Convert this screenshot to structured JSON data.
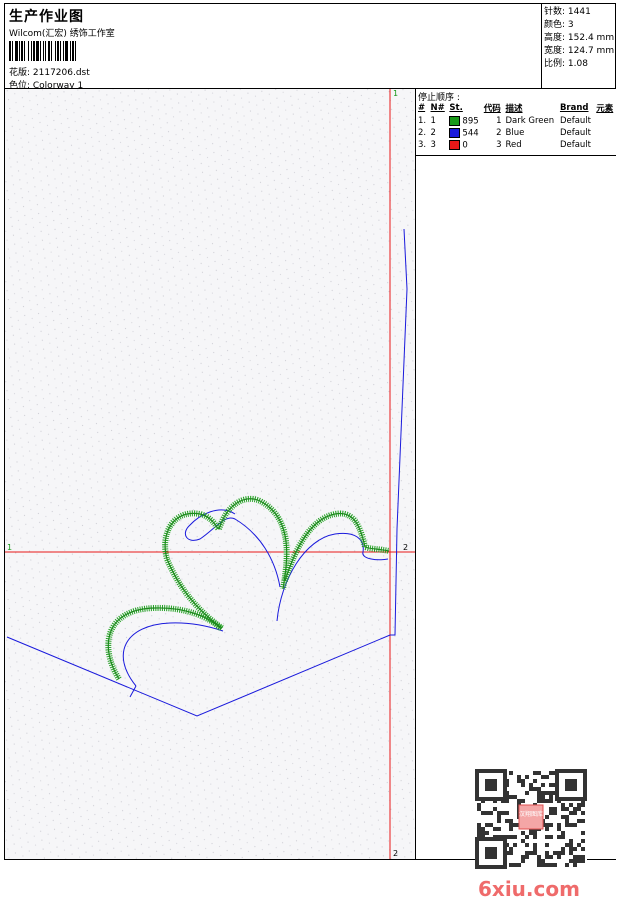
{
  "header": {
    "title": "生产作业图",
    "company": "Wilcom(汇宏) 绣饰工作室",
    "design": "花版: 2117206.dst",
    "colorway": "色位: Colorway 1",
    "stats": [
      {
        "label": "针数",
        "value": "1441"
      },
      {
        "label": "颜色",
        "value": "3"
      },
      {
        "label": "高度",
        "value": "152.4 mm"
      },
      {
        "label": "宽度",
        "value": "124.7 mm"
      },
      {
        "label": "比例",
        "value": "1.08"
      }
    ]
  },
  "markers": {
    "top": "1",
    "left": "1",
    "right": "2",
    "bottom": "2"
  },
  "stop_sequence": {
    "title": "停止顺序 :",
    "columns": [
      "#",
      "N#",
      "St.",
      "代码",
      "描述",
      "Brand",
      "元素"
    ],
    "rows": [
      {
        "idx": "1.",
        "n": "1",
        "color": "#1a9a1a",
        "stitches": "895",
        "code": "1",
        "desc": "Dark Green",
        "brand": "Default"
      },
      {
        "idx": "2.",
        "n": "2",
        "color": "#1a1adc",
        "stitches": "544",
        "code": "2",
        "desc": "Blue",
        "brand": "Default"
      },
      {
        "idx": "3.",
        "n": "3",
        "color": "#e81818",
        "stitches": "0",
        "code": "3",
        "desc": "Red",
        "brand": "Default"
      }
    ]
  },
  "watermark": {
    "qr_label": "汉翔图库",
    "site": "6xiu.com"
  }
}
